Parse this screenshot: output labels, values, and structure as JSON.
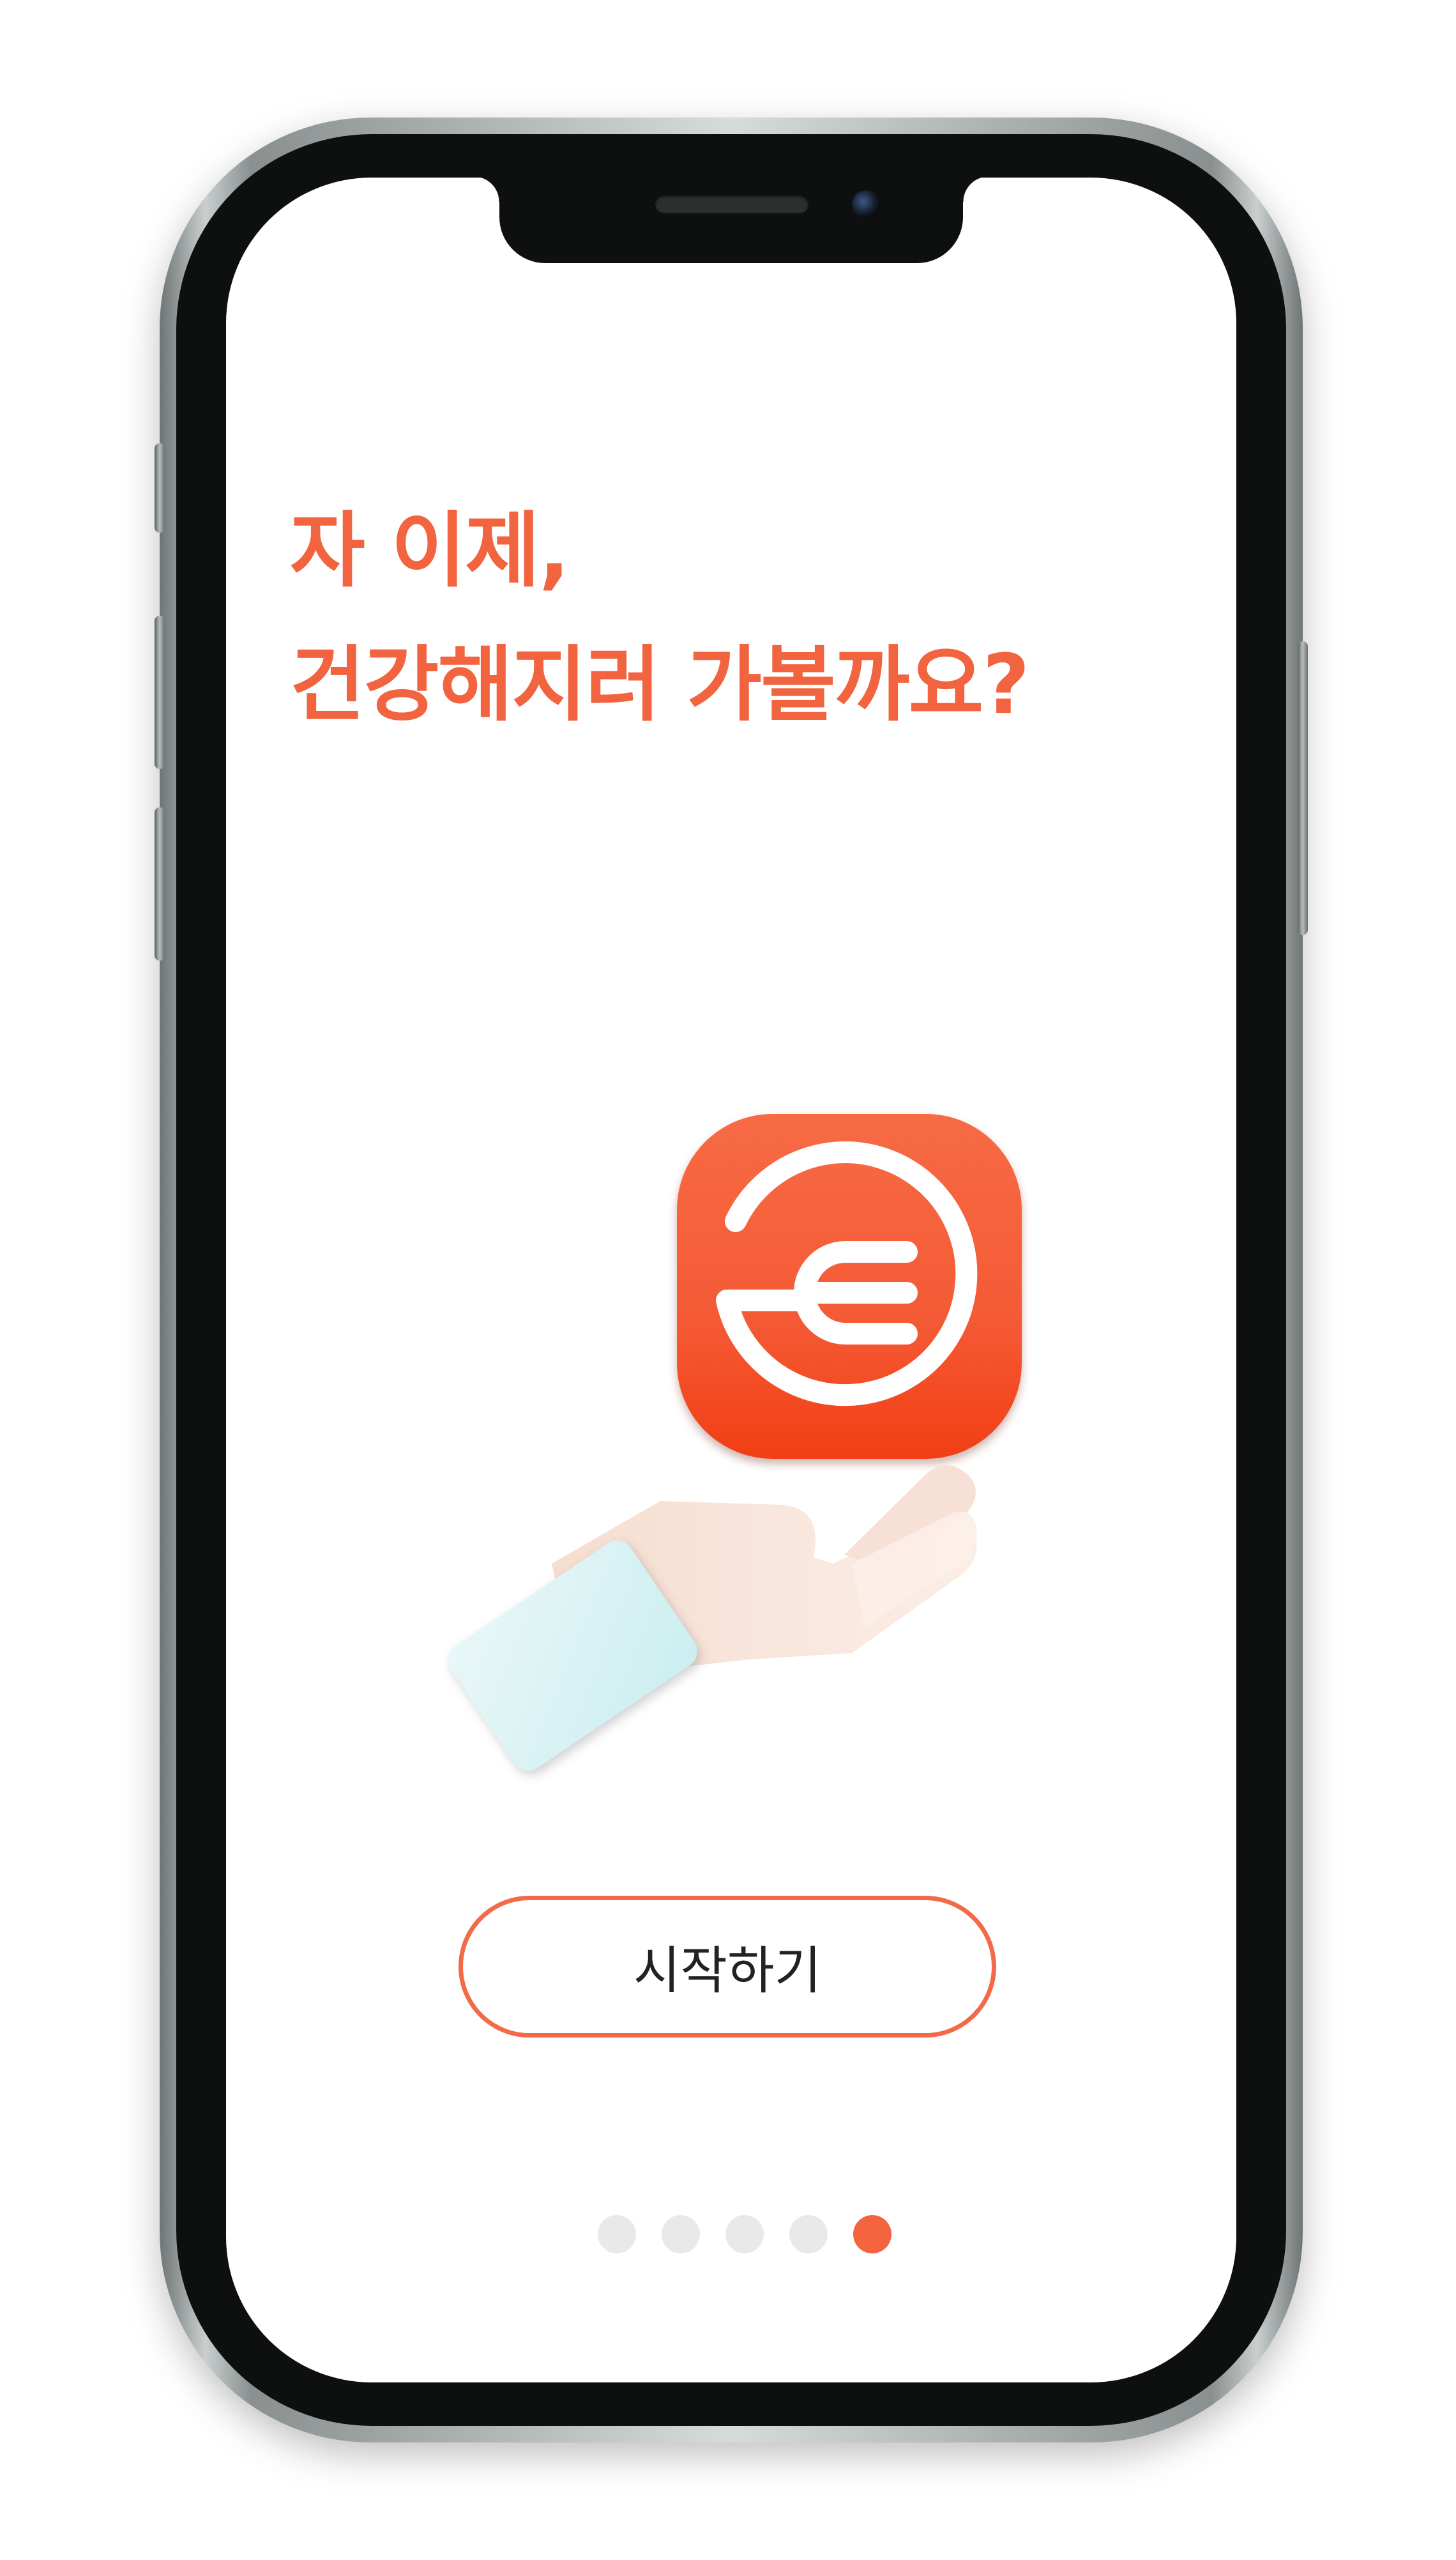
{
  "onboarding": {
    "headline_line1": "자 이제,",
    "headline_line2": "건강해지러 가볼까요?",
    "start_button_label": "시작하기",
    "page_count": 5,
    "current_page": 5
  },
  "colors": {
    "accent": "#f4643e",
    "dot_inactive": "#e9e9e9"
  },
  "icons": {
    "app_logo": "fork-logo-icon",
    "illustration": "hand-offering-illustration"
  }
}
